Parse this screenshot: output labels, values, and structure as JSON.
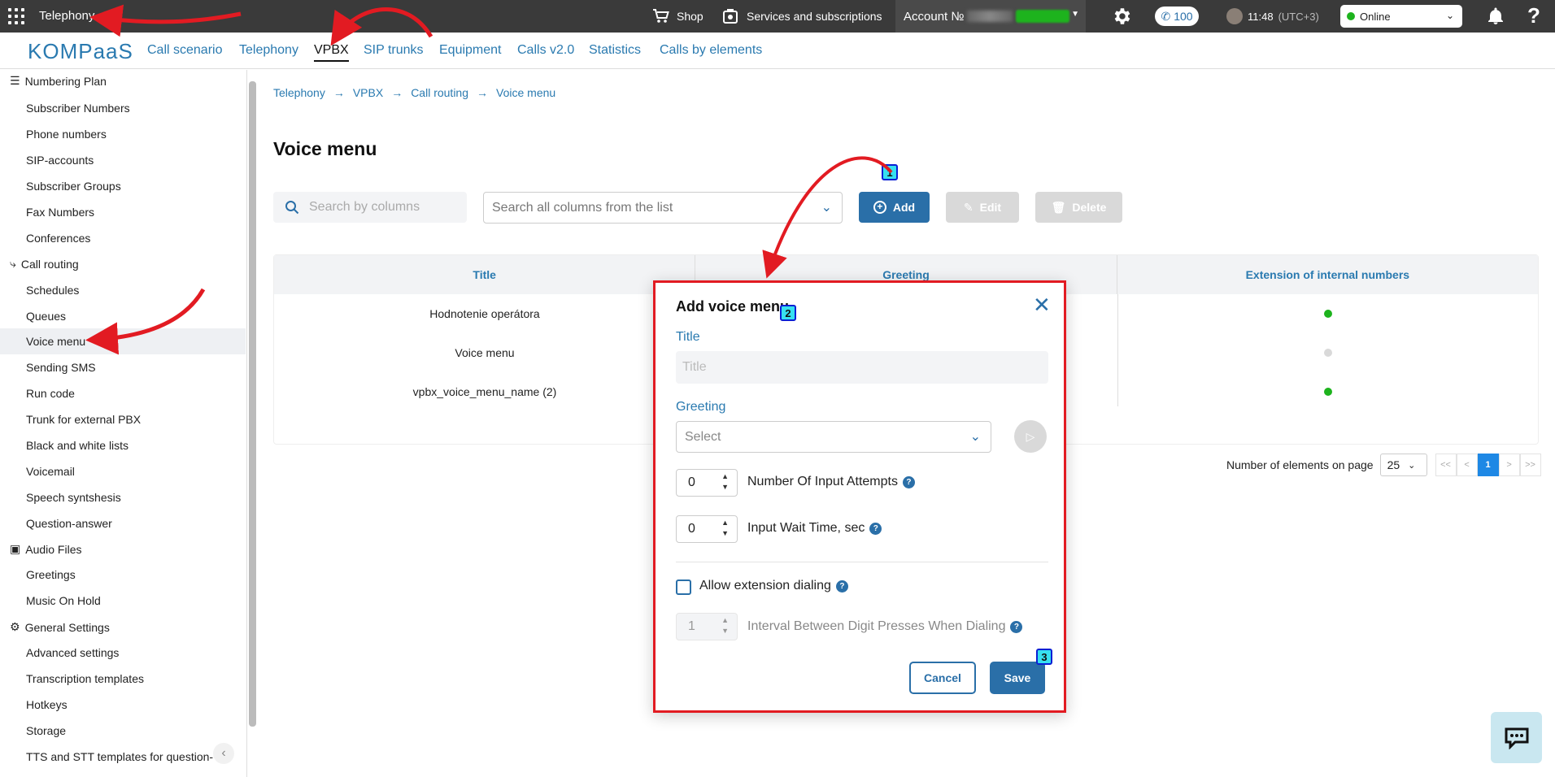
{
  "topbar": {
    "app_title": "Telephony",
    "shop_label": "Shop",
    "services_label": "Services and subscriptions",
    "account_label": "Account №",
    "calls_count": "100",
    "time": "11:48",
    "timezone": "(UTC+3)",
    "status_value": "Online",
    "status_color": "#1db31d",
    "icons": [
      "apps-grid-icon",
      "cart-icon",
      "services-icon",
      "chevron-down-icon",
      "gear-icon",
      "phone-icon",
      "avatar",
      "bell-icon",
      "help-icon"
    ]
  },
  "navbar": {
    "logo": "KOMPaaS",
    "items": [
      "Call scenario",
      "Telephony",
      "VPBX",
      "SIP trunks",
      "Equipment",
      "Calls v2.0",
      "Statistics",
      "Calls by elements"
    ],
    "active": "VPBX"
  },
  "sidebar": {
    "groups": [
      {
        "label": "Numbering Plan",
        "icon": "list-icon",
        "items": [
          "Subscriber Numbers",
          "Phone numbers",
          "SIP-accounts",
          "Subscriber Groups",
          "Fax Numbers",
          "Conferences"
        ]
      },
      {
        "label": "Call routing",
        "icon": "routing-icon",
        "items": [
          "Schedules",
          "Queues",
          "Voice menu",
          "Sending SMS",
          "Run code",
          "Trunk for external PBX",
          "Black and white lists",
          "Voicemail",
          "Speech syntshesis",
          "Question-answer"
        ]
      },
      {
        "label": "Audio Files",
        "icon": "audio-files-icon",
        "items": [
          "Greetings",
          "Music On Hold"
        ]
      },
      {
        "label": "General Settings",
        "icon": "gear-icon",
        "items": [
          "Advanced settings",
          "Transcription templates",
          "Hotkeys",
          "Storage",
          "TTS and STT templates for question-"
        ]
      }
    ],
    "active_item": "Voice menu"
  },
  "breadcrumb": [
    "Telephony",
    "VPBX",
    "Call routing",
    "Voice menu"
  ],
  "page": {
    "title": "Voice menu",
    "search_placeholder": "Search by columns",
    "columns_select_placeholder": "Search all columns from the list",
    "add_label": "Add",
    "edit_label": "Edit",
    "delete_label": "Delete"
  },
  "table": {
    "headers": [
      "Title",
      "Greeting",
      "Extension of internal numbers"
    ],
    "rows": [
      {
        "title": "Hodnotenie operátora",
        "extension_enabled": true
      },
      {
        "title": "Voice menu",
        "extension_enabled": false
      },
      {
        "title": "vpbx_voice_menu_name (2)",
        "extension_enabled": true
      }
    ],
    "enabled_color": "#1db31d",
    "disabled_color": "#d9d9d9"
  },
  "pagination": {
    "label": "Number of elements on page",
    "page_size": "25",
    "first": "<<",
    "prev": "<",
    "current": "1",
    "next": ">",
    "last": ">>"
  },
  "modal": {
    "title": "Add voice menu",
    "title_label": "Title",
    "title_placeholder": "Title",
    "greeting_label": "Greeting",
    "greeting_placeholder": "Select",
    "attempts_value": "0",
    "attempts_label": "Number Of Input Attempts",
    "wait_value": "0",
    "wait_label": "Input Wait Time, sec",
    "allow_ext_label": "Allow extension dialing",
    "interval_value": "1",
    "interval_label": "Interval Between Digit Presses When Dialing",
    "cancel_label": "Cancel",
    "save_label": "Save",
    "help_glyph": "?"
  },
  "annotations": {
    "badges": [
      "1",
      "2",
      "3"
    ],
    "arrow_color": "#e21b22",
    "badge_color": "#37e0f0"
  }
}
